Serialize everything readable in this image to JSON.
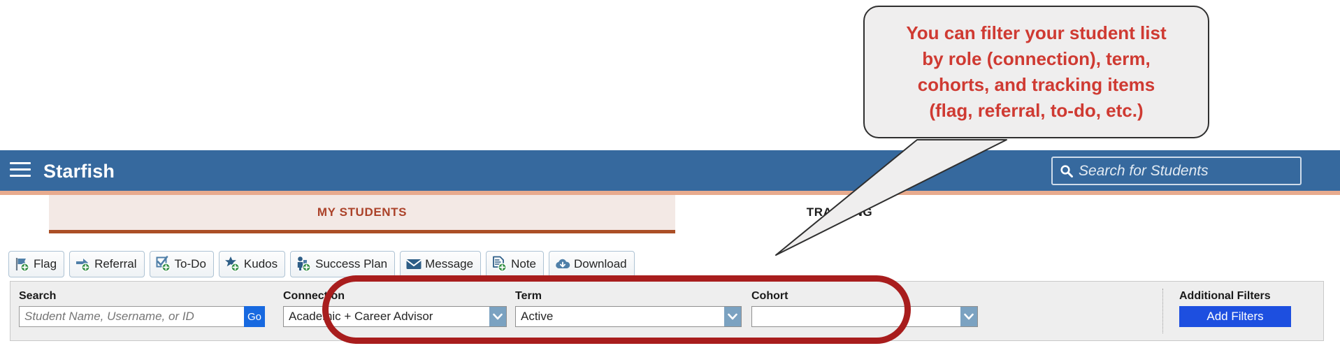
{
  "callout": {
    "text": "You can filter your student list\nby role (connection), term,\ncohorts, and tracking items\n(flag, referral, to-do, etc.)",
    "text_color": "#cf3a32",
    "background": "#efeeee",
    "border_color": "#2f2f2f"
  },
  "appbar": {
    "brand": "Starfish",
    "background": "#36699e",
    "underline_color": "#e8ab8e",
    "menu_icon": "hamburger-icon",
    "search": {
      "icon": "search-icon",
      "placeholder": "Search for Students",
      "value": ""
    }
  },
  "tabs": [
    {
      "label": "MY STUDENTS",
      "active": true,
      "active_color": "#ab4229",
      "active_background": "#f3e9e5",
      "underline_color": "#ab4f26"
    },
    {
      "label": "TRACKING",
      "active": false
    }
  ],
  "toolbar": {
    "buttons": [
      {
        "label": "Flag",
        "icon": "flag-add-icon"
      },
      {
        "label": "Referral",
        "icon": "referral-add-icon"
      },
      {
        "label": "To-Do",
        "icon": "todo-add-icon"
      },
      {
        "label": "Kudos",
        "icon": "kudos-star-add-icon"
      },
      {
        "label": "Success Plan",
        "icon": "success-plan-add-icon"
      },
      {
        "label": "Message",
        "icon": "envelope-icon"
      },
      {
        "label": "Note",
        "icon": "note-add-icon"
      },
      {
        "label": "Download",
        "icon": "cloud-download-icon"
      }
    ]
  },
  "filters": {
    "search": {
      "label": "Search",
      "placeholder": "Student Name, Username, or ID",
      "value": "",
      "go_label": "Go",
      "go_color": "#1769e0"
    },
    "connection": {
      "label": "Connection",
      "value": "Academic + Career Advisor",
      "arrow_icon": "chevron-down-icon"
    },
    "term": {
      "label": "Term",
      "value": "Active",
      "arrow_icon": "chevron-down-icon"
    },
    "cohort": {
      "label": "Cohort",
      "value": "",
      "arrow_icon": "chevron-down-icon"
    },
    "additional": {
      "label": "Additional Filters",
      "button_label": "Add Filters",
      "button_color": "#1d4fe0"
    }
  },
  "annotation": {
    "highlight_color": "#a81d1d",
    "highlight_shape": "oval",
    "pointer": "callout-tail"
  }
}
